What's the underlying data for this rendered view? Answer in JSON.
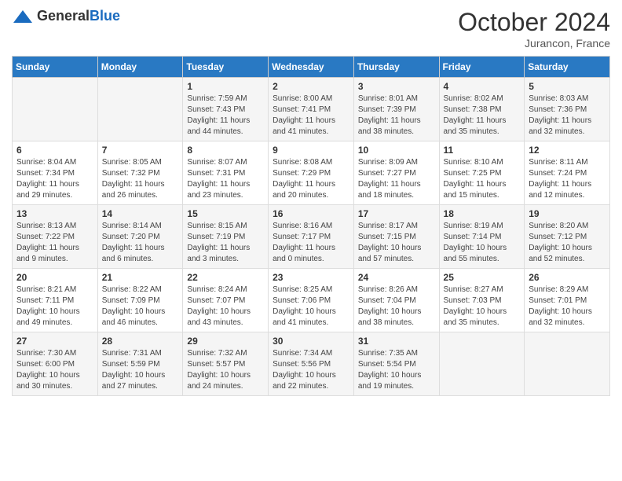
{
  "header": {
    "logo_general": "General",
    "logo_blue": "Blue",
    "month": "October 2024",
    "location": "Jurancon, France"
  },
  "days_of_week": [
    "Sunday",
    "Monday",
    "Tuesday",
    "Wednesday",
    "Thursday",
    "Friday",
    "Saturday"
  ],
  "weeks": [
    [
      {
        "day": "",
        "info": ""
      },
      {
        "day": "",
        "info": ""
      },
      {
        "day": "1",
        "info": "Sunrise: 7:59 AM\nSunset: 7:43 PM\nDaylight: 11 hours and 44 minutes."
      },
      {
        "day": "2",
        "info": "Sunrise: 8:00 AM\nSunset: 7:41 PM\nDaylight: 11 hours and 41 minutes."
      },
      {
        "day": "3",
        "info": "Sunrise: 8:01 AM\nSunset: 7:39 PM\nDaylight: 11 hours and 38 minutes."
      },
      {
        "day": "4",
        "info": "Sunrise: 8:02 AM\nSunset: 7:38 PM\nDaylight: 11 hours and 35 minutes."
      },
      {
        "day": "5",
        "info": "Sunrise: 8:03 AM\nSunset: 7:36 PM\nDaylight: 11 hours and 32 minutes."
      }
    ],
    [
      {
        "day": "6",
        "info": "Sunrise: 8:04 AM\nSunset: 7:34 PM\nDaylight: 11 hours and 29 minutes."
      },
      {
        "day": "7",
        "info": "Sunrise: 8:05 AM\nSunset: 7:32 PM\nDaylight: 11 hours and 26 minutes."
      },
      {
        "day": "8",
        "info": "Sunrise: 8:07 AM\nSunset: 7:31 PM\nDaylight: 11 hours and 23 minutes."
      },
      {
        "day": "9",
        "info": "Sunrise: 8:08 AM\nSunset: 7:29 PM\nDaylight: 11 hours and 20 minutes."
      },
      {
        "day": "10",
        "info": "Sunrise: 8:09 AM\nSunset: 7:27 PM\nDaylight: 11 hours and 18 minutes."
      },
      {
        "day": "11",
        "info": "Sunrise: 8:10 AM\nSunset: 7:25 PM\nDaylight: 11 hours and 15 minutes."
      },
      {
        "day": "12",
        "info": "Sunrise: 8:11 AM\nSunset: 7:24 PM\nDaylight: 11 hours and 12 minutes."
      }
    ],
    [
      {
        "day": "13",
        "info": "Sunrise: 8:13 AM\nSunset: 7:22 PM\nDaylight: 11 hours and 9 minutes."
      },
      {
        "day": "14",
        "info": "Sunrise: 8:14 AM\nSunset: 7:20 PM\nDaylight: 11 hours and 6 minutes."
      },
      {
        "day": "15",
        "info": "Sunrise: 8:15 AM\nSunset: 7:19 PM\nDaylight: 11 hours and 3 minutes."
      },
      {
        "day": "16",
        "info": "Sunrise: 8:16 AM\nSunset: 7:17 PM\nDaylight: 11 hours and 0 minutes."
      },
      {
        "day": "17",
        "info": "Sunrise: 8:17 AM\nSunset: 7:15 PM\nDaylight: 10 hours and 57 minutes."
      },
      {
        "day": "18",
        "info": "Sunrise: 8:19 AM\nSunset: 7:14 PM\nDaylight: 10 hours and 55 minutes."
      },
      {
        "day": "19",
        "info": "Sunrise: 8:20 AM\nSunset: 7:12 PM\nDaylight: 10 hours and 52 minutes."
      }
    ],
    [
      {
        "day": "20",
        "info": "Sunrise: 8:21 AM\nSunset: 7:11 PM\nDaylight: 10 hours and 49 minutes."
      },
      {
        "day": "21",
        "info": "Sunrise: 8:22 AM\nSunset: 7:09 PM\nDaylight: 10 hours and 46 minutes."
      },
      {
        "day": "22",
        "info": "Sunrise: 8:24 AM\nSunset: 7:07 PM\nDaylight: 10 hours and 43 minutes."
      },
      {
        "day": "23",
        "info": "Sunrise: 8:25 AM\nSunset: 7:06 PM\nDaylight: 10 hours and 41 minutes."
      },
      {
        "day": "24",
        "info": "Sunrise: 8:26 AM\nSunset: 7:04 PM\nDaylight: 10 hours and 38 minutes."
      },
      {
        "day": "25",
        "info": "Sunrise: 8:27 AM\nSunset: 7:03 PM\nDaylight: 10 hours and 35 minutes."
      },
      {
        "day": "26",
        "info": "Sunrise: 8:29 AM\nSunset: 7:01 PM\nDaylight: 10 hours and 32 minutes."
      }
    ],
    [
      {
        "day": "27",
        "info": "Sunrise: 7:30 AM\nSunset: 6:00 PM\nDaylight: 10 hours and 30 minutes."
      },
      {
        "day": "28",
        "info": "Sunrise: 7:31 AM\nSunset: 5:59 PM\nDaylight: 10 hours and 27 minutes."
      },
      {
        "day": "29",
        "info": "Sunrise: 7:32 AM\nSunset: 5:57 PM\nDaylight: 10 hours and 24 minutes."
      },
      {
        "day": "30",
        "info": "Sunrise: 7:34 AM\nSunset: 5:56 PM\nDaylight: 10 hours and 22 minutes."
      },
      {
        "day": "31",
        "info": "Sunrise: 7:35 AM\nSunset: 5:54 PM\nDaylight: 10 hours and 19 minutes."
      },
      {
        "day": "",
        "info": ""
      },
      {
        "day": "",
        "info": ""
      }
    ]
  ]
}
